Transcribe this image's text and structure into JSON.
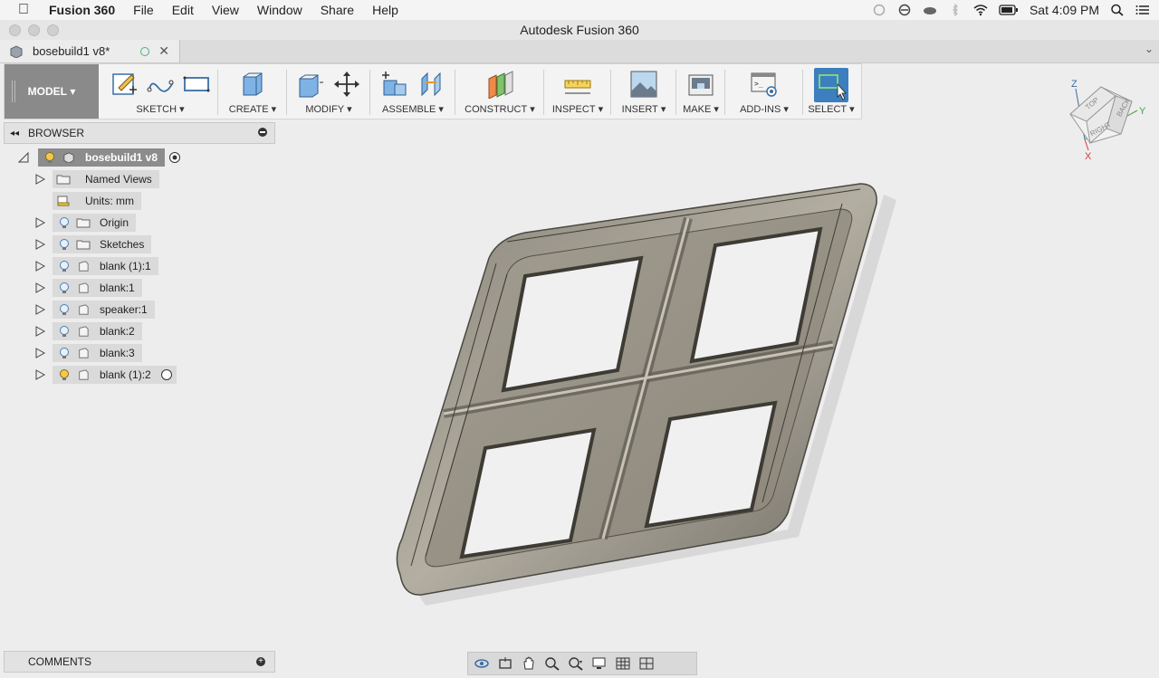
{
  "menubar": {
    "app_name": "Fusion 360",
    "items": [
      "File",
      "Edit",
      "View",
      "Window",
      "Share",
      "Help"
    ],
    "clock": "Sat 4:09 PM"
  },
  "window": {
    "title": "Autodesk Fusion 360"
  },
  "tab": {
    "name": "bosebuild1 v8*"
  },
  "ribbon": {
    "workspace": "MODEL",
    "groups": [
      "SKETCH",
      "CREATE",
      "MODIFY",
      "ASSEMBLE",
      "CONSTRUCT",
      "INSPECT",
      "INSERT",
      "MAKE",
      "ADD-INS",
      "SELECT"
    ]
  },
  "browser": {
    "title": "BROWSER",
    "root": "bosebuild1 v8",
    "items": [
      {
        "label": "Named Views"
      },
      {
        "label": "Units: mm"
      },
      {
        "label": "Origin"
      },
      {
        "label": "Sketches"
      },
      {
        "label": "blank (1):1"
      },
      {
        "label": "blank:1"
      },
      {
        "label": "speaker:1"
      },
      {
        "label": "blank:2"
      },
      {
        "label": "blank:3"
      },
      {
        "label": "blank (1):2"
      }
    ]
  },
  "viewcube": {
    "labels": [
      "TOP",
      "BACK",
      "RIGHT"
    ],
    "axes": [
      "Z",
      "X",
      "Y"
    ]
  },
  "comments": {
    "title": "COMMENTS"
  }
}
